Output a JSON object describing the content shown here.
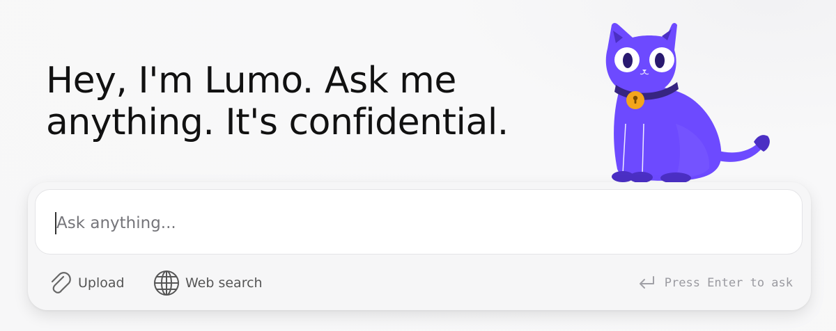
{
  "greeting": {
    "line1": "Hey, I'm Lumo. Ask me",
    "line2": "anything. It's confidential."
  },
  "mascot": {
    "name": "cat-mascot",
    "body_color": "#6D4AFF",
    "shadow_color": "#4B2FC4",
    "collar_color": "#372580",
    "bell_color": "#F4A51C"
  },
  "composer": {
    "placeholder": "Ask anything...",
    "value": ""
  },
  "toolbar": {
    "upload": {
      "icon": "paperclip-icon",
      "label": "Upload"
    },
    "web_search": {
      "icon": "globe-icon",
      "label": "Web search"
    }
  },
  "hint": {
    "icon": "enter-key-icon",
    "text": "Press Enter to ask"
  }
}
